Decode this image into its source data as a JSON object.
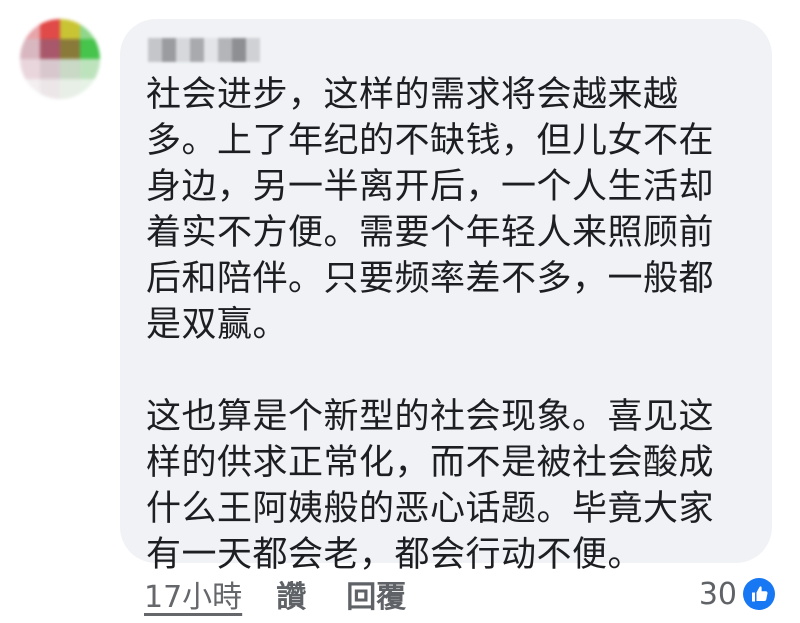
{
  "comment": {
    "author_name": "",
    "paragraphs": [
      "社会进步，这样的需求将会越来越\n多。上了年纪的不缺钱，但儿女不在\n身边，另一半离开后，一个人生活却\n着实不方便。需要个年轻人来照顾前\n后和陪伴。只要频率差不多，一般都\n是双赢。",
      "这也算是个新型的社会现象。喜见这\n样的供求正常化，而不是被社会酸成\n什么王阿姨般的恶心话题。毕竟大家\n有一天都会老，都会行动不便。"
    ],
    "timestamp": "17小時",
    "like_label": "讚",
    "reply_label": "回覆",
    "reaction_count": "30",
    "reaction_icon": "thumbs-up-icon"
  },
  "colors": {
    "bubble": "#f0f2f5",
    "text": "#1c1e21",
    "meta": "#65676b",
    "like_blue": "#1877f2"
  }
}
